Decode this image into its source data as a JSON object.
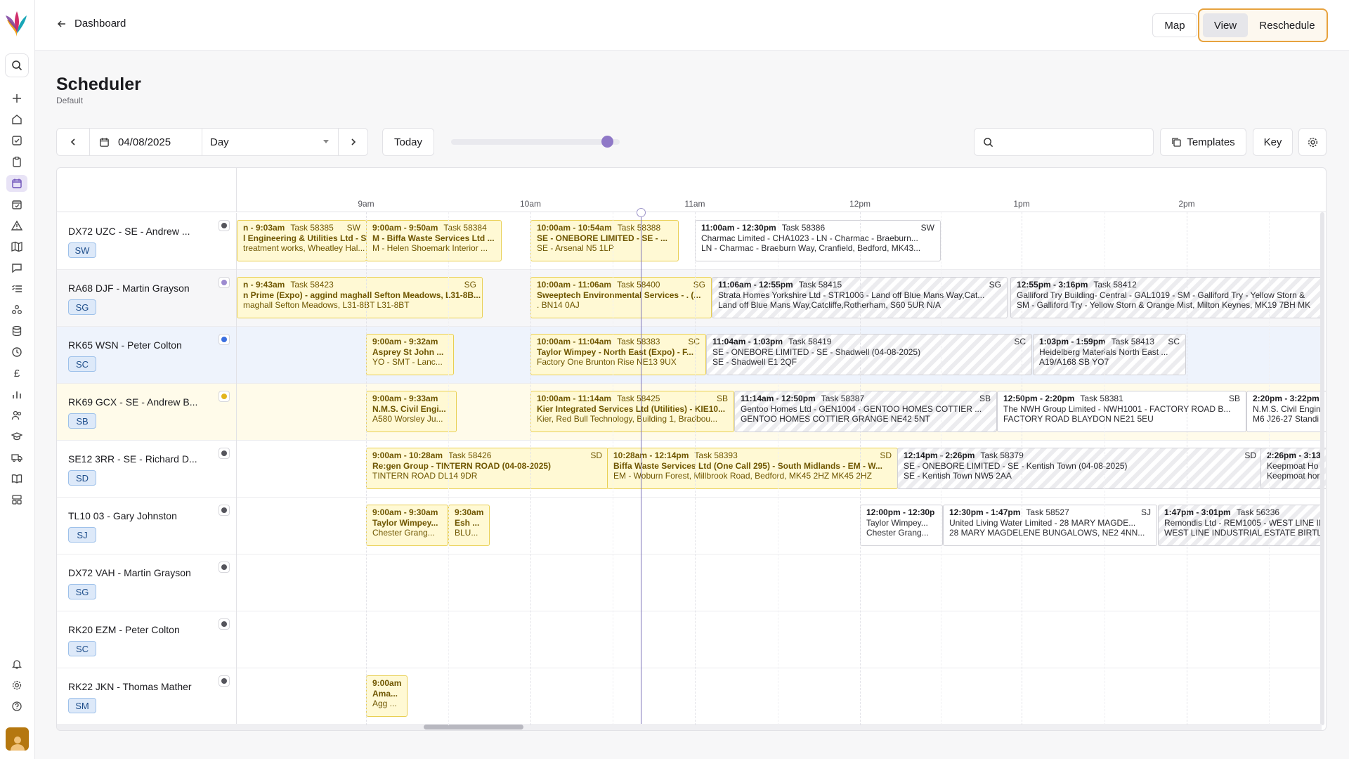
{
  "nav": {
    "back_label": "Dashboard",
    "map_label": "Map",
    "view_label": "View",
    "reschedule_label": "Reschedule"
  },
  "page": {
    "title": "Scheduler",
    "subtitle": "Default"
  },
  "toolbar": {
    "date_value": "04/08/2025",
    "view_select": "Day",
    "today_label": "Today",
    "zoom_level": 0.92,
    "search_placeholder": "",
    "templates_label": "Templates",
    "key_label": "Key"
  },
  "timeline": {
    "hours": [
      "9am",
      "10am",
      "11am",
      "12pm",
      "1pm",
      "2pm"
    ]
  },
  "resources": [
    {
      "name": "DX72 UZC - SE - Andrew ...",
      "code": "SW",
      "status_color": "#55555c",
      "tint": "#ffffff"
    },
    {
      "name": "RA68 DJF - Martin Grayson",
      "code": "SG",
      "status_color": "#9d8bd0",
      "tint": "#f6f6f8"
    },
    {
      "name": "RK65 WSN - Peter Colton",
      "code": "SC",
      "status_color": "#3b6fe0",
      "tint": "#eef3fc"
    },
    {
      "name": "RK69 GCX - SE - Andrew B...",
      "code": "SB",
      "status_color": "#e3b51c",
      "tint": "#fffbea"
    },
    {
      "name": "SE12 3RR - SE - Richard D...",
      "code": "SD",
      "status_color": "#55555c",
      "tint": "#ffffff"
    },
    {
      "name": "TL10 03 - Gary Johnston",
      "code": "SJ",
      "status_color": "#55555c",
      "tint": "#ffffff"
    },
    {
      "name": "DX72 VAH - Martin Grayson",
      "code": "SG",
      "status_color": "#55555c",
      "tint": "#ffffff"
    },
    {
      "name": "RK20 EZM - Peter Colton",
      "code": "SC",
      "status_color": "#55555c",
      "tint": "#ffffff"
    },
    {
      "name": "RK22 JKN - Thomas Mather",
      "code": "SM",
      "status_color": "#55555c",
      "tint": "#ffffff"
    }
  ],
  "tasks": [
    [
      {
        "time": "n - 9:03am",
        "task": "Task 58385",
        "code": "SW",
        "line2": "l Engineering & Utilities Ltd - S...",
        "line3": "treatment works, Wheatley Hal...",
        "style": "yellow"
      },
      {
        "time": "9:00am - 9:50am",
        "task": "Task 58384",
        "code": "",
        "line2": "M - Biffa Waste Services Ltd ...",
        "line3": "M - Helen Shoemark Interior ...",
        "style": "yellow"
      },
      {
        "time": "10:00am - 10:54am",
        "task": "Task 58388",
        "code": "",
        "line2": "SE - ONEBORE LIMITED - SE - ...",
        "line3": "SE - Arsenal N5 1LP",
        "style": "yellow"
      },
      {
        "time": "11:00am - 12:30pm",
        "task": "Task 58386",
        "code": "SW",
        "line2": "Charmac Limited - CHA1023 - LN - Charmac - Braeburn...",
        "line3": "LN - Charmac - Braeburn Way, Cranfield, Bedford, MK43...",
        "style": "gray"
      }
    ],
    [
      {
        "time": "n - 9:43am",
        "task": "Task 58423",
        "code": "SG",
        "line2": "n Prime (Expo) - aggind maghall Sefton Meadows, L31-8B...",
        "line3": "maghall Sefton Meadows, L31-8BT L31-8BT",
        "style": "yellow"
      },
      {
        "time": "10:00am - 11:06am",
        "task": "Task 58400",
        "code": "SG",
        "line2": "Sweeptech Environmental Services - . (...",
        "line3": ". BN14 0AJ",
        "style": "yellow"
      },
      {
        "time": "11:06am - 12:55pm",
        "task": "Task 58415",
        "code": "SG",
        "line2": "Strata Homes Yorkshire Ltd - STR1006 - Land off Blue Mans Way,Cat...",
        "line3": "Land off Blue Mans Way,Catcliffe,Rotherham, S60 5UR N/A",
        "style": "gray hatch"
      },
      {
        "time": "12:55pm - 3:16pm",
        "task": "Task 58412",
        "code": "",
        "line2": "Galliford Try Building- Central - GAL1019 - SM - Galliford Try - Yellow Storn &",
        "line3": "SM - Galliford Try - Yellow Storn & Orange Mist, Milton Keynes, MK19 7BH MK",
        "style": "gray hatch"
      }
    ],
    [
      {
        "time": "9:00am - 9:32am",
        "task": "",
        "code": "",
        "line2": "Asprey St John ...",
        "line3": "YO - SMT - Lanc...",
        "style": "yellow"
      },
      {
        "time": "10:00am - 11:04am",
        "task": "Task 58383",
        "code": "SC",
        "line2": "Taylor Wimpey - North East (Expo) - F...",
        "line3": "Factory One Brunton Rise NE13 9UX",
        "style": "yellow"
      },
      {
        "time": "11:04am - 1:03pm",
        "task": "Task 58419",
        "code": "SC",
        "line2": "SE - ONEBORE LIMITED - SE - Shadwell (04-08-2025)",
        "line3": "SE - Shadwell E1 2QF",
        "style": "gray hatch"
      },
      {
        "time": "1:03pm - 1:59pm",
        "task": "Task 58413",
        "code": "SC",
        "line2": "Heidelberg Materials North East ...",
        "line3": "A19/A168 SB YO7",
        "style": "gray hatch"
      }
    ],
    [
      {
        "time": "9:00am - 9:33am",
        "task": "",
        "code": "",
        "line2": "N.M.S. Civil Engi...",
        "line3": "A580 Worsley Ju...",
        "style": "yellow"
      },
      {
        "time": "10:00am - 11:14am",
        "task": "Task 58425",
        "code": "SB",
        "line2": "Kier Integrated Services Ltd (Utilities) - KIE10...",
        "line3": "Kier, Red Bull Technology, Building 1, Bradbou...",
        "style": "yellow"
      },
      {
        "time": "11:14am - 12:50pm",
        "task": "Task 58387",
        "code": "SB",
        "line2": "Gentoo Homes Ltd - GEN1004 - GENTOO HOMES COTTIER ...",
        "line3": "GENTOO HOMES COTTIER GRANGE NE42 5NT",
        "style": "gray hatch"
      },
      {
        "time": "12:50pm - 2:20pm",
        "task": "Task 58381",
        "code": "SB",
        "line2": "The NWH Group Limited - NWH1001 - FACTORY ROAD B...",
        "line3": "FACTORY ROAD BLAYDON NE21 5EU",
        "style": "gray"
      },
      {
        "time": "2:20pm - 3:22pm",
        "task": "",
        "code": "",
        "line2": "N.M.S. Civil Engin",
        "line3": "M6 J26-27 Standi",
        "style": "gray"
      }
    ],
    [
      {
        "time": "9:00am - 10:28am",
        "task": "Task 58426",
        "code": "SD",
        "line2": "Re:gen Group - TINTERN ROAD (04-08-2025)",
        "line3": "TINTERN ROAD DL14 9DR",
        "style": "yellow"
      },
      {
        "time": "10:28am - 12:14pm",
        "task": "Task 58393",
        "code": "SD",
        "line2": "Biffa Waste Services Ltd (One Call 295) - South Midlands - EM - W...",
        "line3": "EM - Woburn Forest, Millbrook Road, Bedford, MK45 2HZ MK45 2HZ",
        "style": "yellow"
      },
      {
        "time": "12:14pm - 2:26pm",
        "task": "Task 58379",
        "code": "SD",
        "line2": "SE - ONEBORE LIMITED - SE - Kentish Town (04-08-2025)",
        "line3": "SE - Kentish Town NW5 2AA",
        "style": "gray hatch"
      },
      {
        "time": "2:26pm - 3:13",
        "task": "",
        "code": "",
        "line2": "Keepmoat Ho",
        "line3": "Keepmoat hor",
        "style": "gray hatch"
      }
    ],
    [
      {
        "time": "9:00am - 9:30am",
        "task": "",
        "code": "",
        "line2": "Taylor Wimpey...",
        "line3": "Chester Grang...",
        "style": "yellow"
      },
      {
        "time": "9:30am",
        "task": "",
        "code": "",
        "line2": "Esh ...",
        "line3": "BLU...",
        "style": "yellow"
      },
      {
        "time": "12:00pm - 12:30p",
        "task": "",
        "code": "",
        "line2": "Taylor Wimpey...",
        "line3": "Chester Grang...",
        "style": "gray"
      },
      {
        "time": "12:30pm - 1:47pm",
        "task": "Task 58527",
        "code": "SJ",
        "line2": "United Living Water Limited - 28 MARY MAGDE...",
        "line3": "28 MARY MAGDELENE BUNGALOWS, NE2 4NN...",
        "style": "gray"
      },
      {
        "time": "1:47pm - 3:01pm",
        "task": "Task 56336",
        "code": "",
        "line2": "Remondis Ltd - REM1005 - WEST LINE IN",
        "line3": "WEST LINE INDUSTRIAL ESTATE BIRTLE",
        "style": "gray hatch"
      }
    ],
    [],
    [],
    [
      {
        "time": "9:00am",
        "task": "",
        "code": "",
        "line2": "Ama...",
        "line3": "Agg ...",
        "style": "yellow"
      }
    ]
  ]
}
